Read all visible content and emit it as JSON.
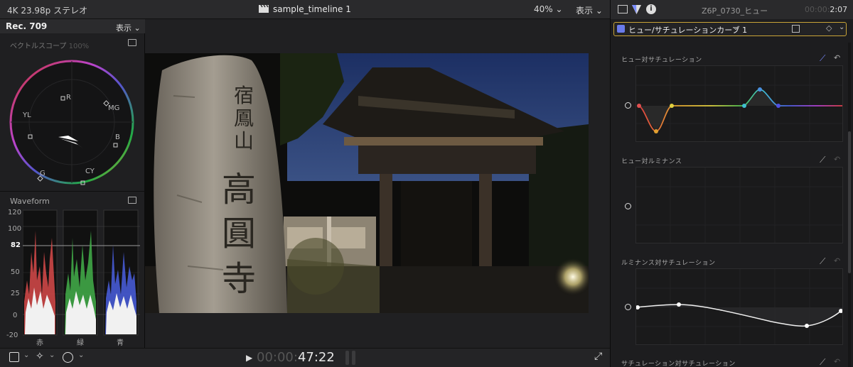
{
  "topbar": {
    "format": "4K 23.98p ステレオ",
    "timeline": "sample_timeline 1",
    "zoom": "40%",
    "view": "表示"
  },
  "scopes": {
    "colorspace": "Rec. 709",
    "view_menu": "表示",
    "vectorscope": {
      "title": "ベクトルスコープ",
      "pct": "100%",
      "labels": [
        "R",
        "MG",
        "B",
        "CY",
        "G",
        "YL"
      ]
    },
    "waveform": {
      "title": "Waveform",
      "ticks": [
        "120",
        "100",
        "82",
        "50",
        "25",
        "0",
        "-20"
      ],
      "channels": [
        "赤",
        "緑",
        "青"
      ]
    }
  },
  "viewer": {
    "sign_kanji": [
      "宿",
      "鳳",
      "山",
      "高",
      "圓",
      "寺"
    ]
  },
  "transport": {
    "timecode_dim": "00:00:",
    "timecode_bright": "47:22"
  },
  "inspector": {
    "clip_name": "Z6P_0730_ヒュー",
    "duration_dim": "00:00:",
    "duration_bright": "2:07",
    "effect_name": "ヒュー/サチュレーションカーブ 1",
    "curves": [
      {
        "title": "ヒュー対サチュレーション"
      },
      {
        "title": "ヒュー対ルミナンス"
      },
      {
        "title": "ルミナンス対サチュレーション"
      },
      {
        "title": "サチュレーション対サチュレーション"
      }
    ]
  },
  "colors": {
    "accent": "#7a8cff",
    "effect_border": "#c9a437",
    "waveform_line": "#e0e0e0"
  }
}
